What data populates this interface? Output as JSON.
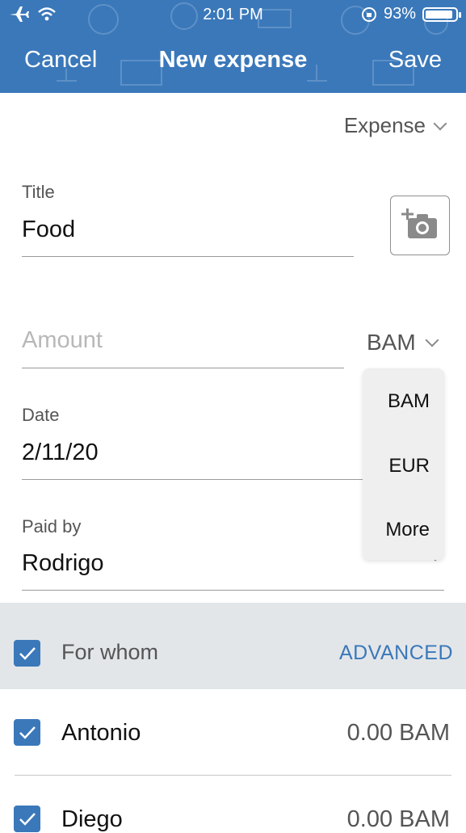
{
  "status_bar": {
    "time": "2:01 PM",
    "battery": "93%",
    "battery_level": 0.93
  },
  "nav": {
    "cancel": "Cancel",
    "title": "New expense",
    "save": "Save"
  },
  "type_select": {
    "value": "Expense"
  },
  "title_field": {
    "label": "Title",
    "value": "Food"
  },
  "amount_field": {
    "placeholder": "Amount",
    "currency": "BAM"
  },
  "currency_menu": {
    "options": [
      "BAM",
      "EUR",
      "More"
    ]
  },
  "date_field": {
    "label": "Date",
    "value": "2/11/20"
  },
  "paid_by": {
    "label": "Paid by",
    "value": "Rodrigo"
  },
  "for_whom": {
    "label": "For whom",
    "advanced": "ADVANCED",
    "people": [
      {
        "name": "Antonio",
        "amount": "0.00 BAM"
      },
      {
        "name": "Diego",
        "amount": "0.00 BAM"
      }
    ]
  },
  "colors": {
    "accent": "#3a78ba",
    "header": "#3a78ba",
    "section_bg": "#e3e6e9"
  }
}
